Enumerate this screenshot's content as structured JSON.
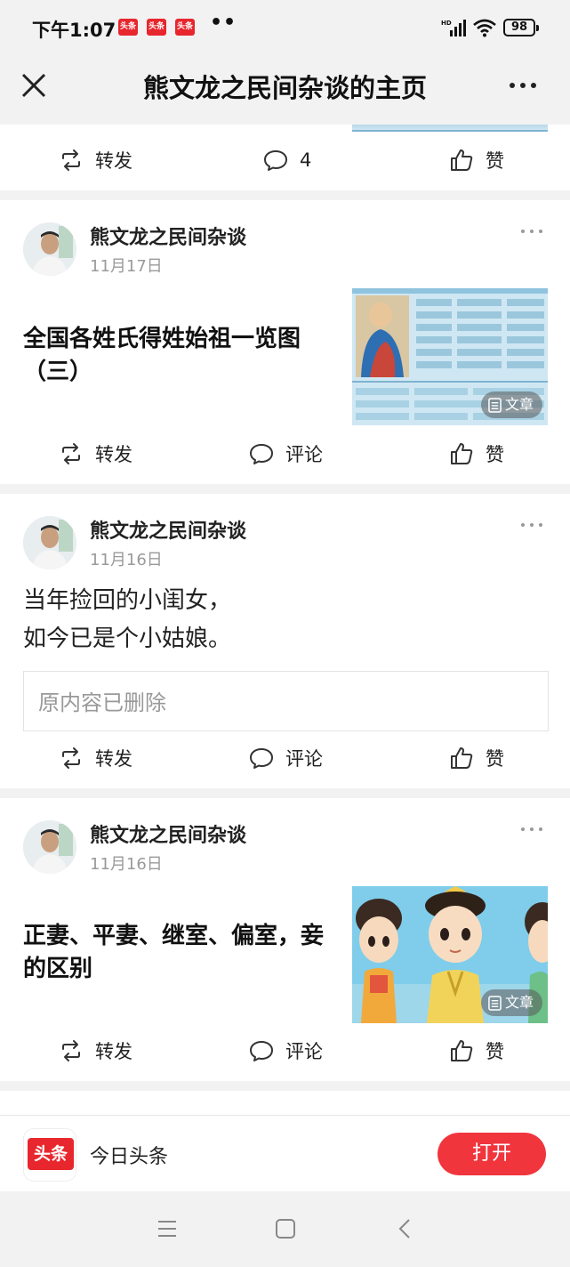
{
  "status_bar": {
    "time": "下午1:07",
    "app_badge": "头条",
    "dots": "••",
    "battery": "98"
  },
  "nav": {
    "title": "熊文龙之民间杂谈的主页"
  },
  "colors": {
    "brand_red": "#e8262d",
    "open_button": "#f0353d"
  },
  "top_card": {
    "repost": "转发",
    "comment_count": "4",
    "like": "赞"
  },
  "posts": [
    {
      "author": "熊文龙之民间杂谈",
      "date": "11月17日",
      "title": "全国各姓氏得姓始祖一览图（三）",
      "badge": "文章",
      "repost": "转发",
      "comment": "评论",
      "like": "赞"
    },
    {
      "author": "熊文龙之民间杂谈",
      "date": "11月16日",
      "text_line1": "当年捡回的小闺女，",
      "text_line2": "如今已是个小姑娘。",
      "deleted": "原内容已删除",
      "repost": "转发",
      "comment": "评论",
      "like": "赞"
    },
    {
      "author": "熊文龙之民间杂谈",
      "date": "11月16日",
      "title": "正妻、平妻、继室、偏室，妾的区别",
      "badge": "文章",
      "repost": "转发",
      "comment": "评论",
      "like": "赞"
    }
  ],
  "banner": {
    "logo_text": "头条",
    "app_name": "今日头条",
    "open": "打开"
  },
  "icons": [
    "close-icon",
    "more-icon",
    "repost-icon",
    "comment-icon",
    "like-icon",
    "article-icon",
    "menu-icon",
    "home-icon",
    "back-icon"
  ]
}
